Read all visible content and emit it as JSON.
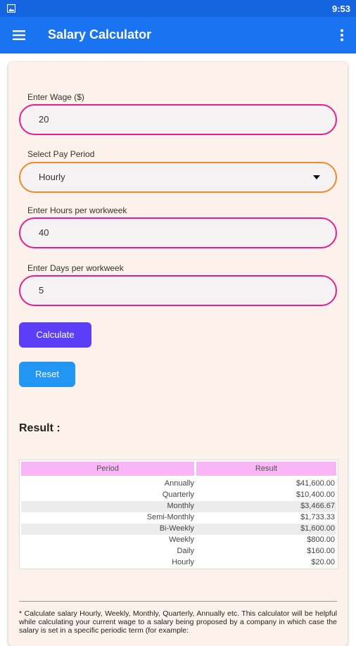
{
  "status_bar": {
    "time": "9:53"
  },
  "app_bar": {
    "title": "Salary Calculator"
  },
  "form": {
    "wage_label": "Enter Wage ($)",
    "wage_value": "20",
    "period_label": "Select Pay Period",
    "period_value": "Hourly",
    "hours_label": "Enter Hours per workweek",
    "hours_value": "40",
    "days_label": "Enter Days per workweek",
    "days_value": "5"
  },
  "buttons": {
    "calculate": "Calculate",
    "reset": "Reset"
  },
  "result": {
    "title": "Result :",
    "headers": [
      "Period",
      "Result"
    ],
    "rows": [
      [
        "Annually",
        "$41,600.00"
      ],
      [
        "Quarterly",
        "$10,400.00"
      ],
      [
        "Monthly",
        "$3,466.67"
      ],
      [
        "Semi-Monthly",
        "$1,733.33"
      ],
      [
        "Bi-Weekly",
        "$1,600.00"
      ],
      [
        "Weekly",
        "$800.00"
      ],
      [
        "Daily",
        "$160.00"
      ],
      [
        "Hourly",
        "$20.00"
      ]
    ]
  },
  "footnote": "* Calculate salary Hourly, Weekly, Monthly, Quarterly, Annually etc. This calculator will be helpful while calculating your current wage to a salary being proposed by a company in which case the salary is set in a specific periodic term (for example:",
  "colors": {
    "app_bar": "#1a73f0",
    "field_border": "#e91e8c",
    "select_border": "#f08a28",
    "calculate_button": "#5b3ef5",
    "reset_button": "#2196f3",
    "table_header": "#f9b6f6",
    "card_background": "#fdf1ec"
  },
  "icons": {
    "status_left": "image-icon",
    "menu": "menu-icon",
    "more": "more-vert-icon",
    "dropdown": "caret-down-icon"
  }
}
